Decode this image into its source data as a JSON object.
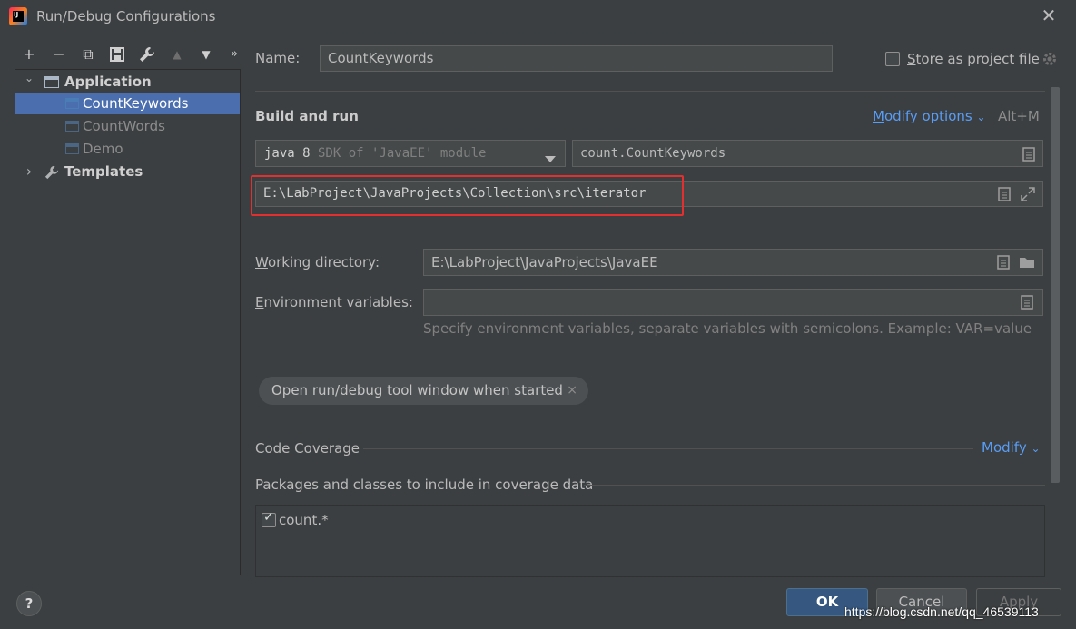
{
  "window": {
    "title": "Run/Debug Configurations",
    "close_glyph": "✕",
    "app_icon_text": "IJ"
  },
  "toolbar": {
    "add": "+",
    "remove": "−",
    "copy": "⧉",
    "save": "💾",
    "edit": "🔧",
    "up": "▲",
    "down": "▼",
    "more": "»"
  },
  "tree": {
    "application": {
      "label": "Application",
      "arrow": "⌄"
    },
    "items": [
      {
        "label": "CountKeywords"
      },
      {
        "label": "CountWords"
      },
      {
        "label": "Demo"
      }
    ],
    "templates": {
      "label": "Templates",
      "arrow": "›"
    }
  },
  "name": {
    "label_u": "N",
    "label_rest": "ame:",
    "value": "CountKeywords"
  },
  "store": {
    "label_u": "S",
    "label_rest": "tore as project file",
    "checked": false
  },
  "build_run": {
    "title": "Build and run",
    "modify_options_u": "M",
    "modify_options_rest": "odify options",
    "modify_chevron": "⌄",
    "shortcut": "Alt+M",
    "sdk_bold": "java 8",
    "sdk_rest": " SDK of 'JavaEE' module",
    "main_class": "count.CountKeywords",
    "program_args": "E:\\LabProject\\JavaProjects\\Collection\\src\\iterator"
  },
  "working_dir": {
    "label_u": "W",
    "label_rest": "orking directory:",
    "value": "E:\\LabProject\\JavaProjects\\JavaEE"
  },
  "env_vars": {
    "label_u": "E",
    "label_rest": "nvironment variables:",
    "value": "",
    "hint": "Specify environment variables, separate variables with semicolons. Example: VAR=value"
  },
  "chip": {
    "label": "Open run/debug tool window when started",
    "close": "×"
  },
  "coverage": {
    "title": "Code Coverage",
    "modify": "Modify",
    "modify_chevron": "⌄",
    "packages_title": "Packages and classes to include in coverage data",
    "entries": [
      {
        "label": "count.*",
        "checked": true
      }
    ]
  },
  "buttons": {
    "ok": "OK",
    "cancel": "Cancel",
    "apply": "Apply",
    "help": "?"
  },
  "watermark": "https://blog.csdn.net/qq_46539113",
  "colors": {
    "accent": "#589df6",
    "selection": "#4b6eaf",
    "highlight": "#e0302f",
    "background": "#3c3f41"
  }
}
